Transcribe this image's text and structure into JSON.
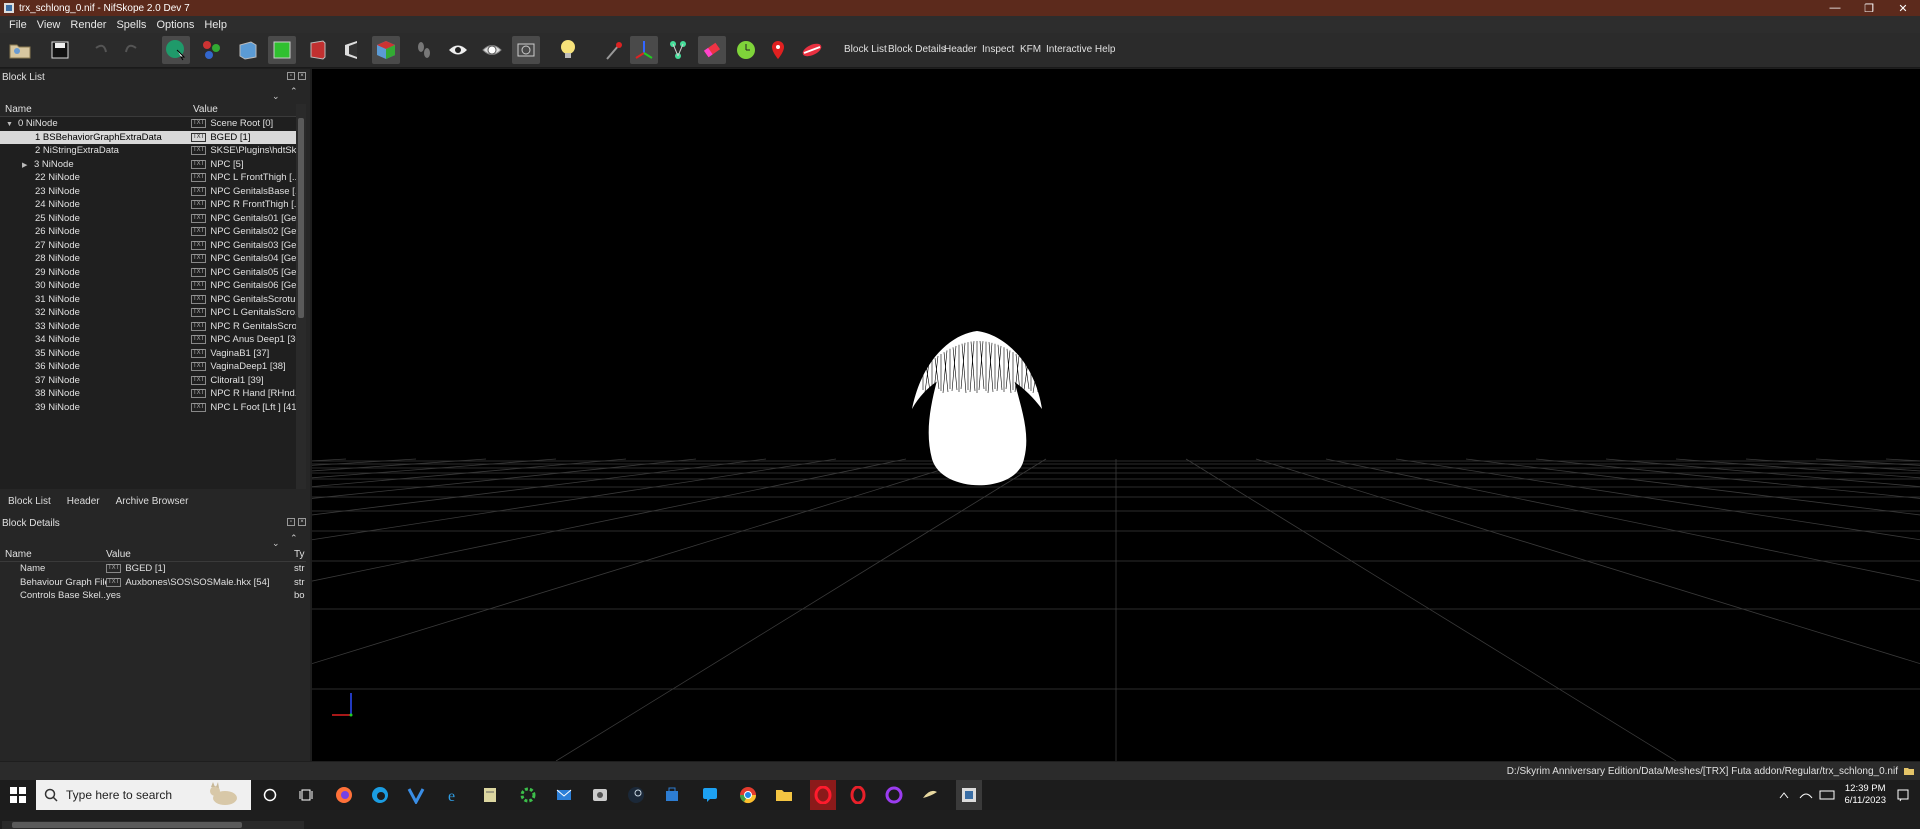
{
  "window": {
    "title": "trx_schlong_0.nif - NifSkope 2.0 Dev 7",
    "controls": {
      "minimize": "—",
      "maximize": "❐",
      "close": "✕"
    }
  },
  "menu": [
    "File",
    "View",
    "Render",
    "Spells",
    "Options",
    "Help"
  ],
  "toolbar": {
    "text_buttons": [
      "Block List",
      "Block Details",
      "Header",
      "Inspect",
      "KFM",
      "Interactive Help"
    ]
  },
  "block_list": {
    "title": "Block List",
    "columns": {
      "name": "Name",
      "value": "Value"
    },
    "rows": [
      {
        "name": "0 NiNode",
        "value": "Scene Root [0]"
      },
      {
        "name": "1 BSBehaviorGraphExtraData",
        "value": "BGED [1]"
      },
      {
        "name": "2 NiStringExtraData",
        "value": "SKSE\\Plugins\\hdtSk..."
      },
      {
        "name": "3 NiNode",
        "value": "NPC [5]"
      },
      {
        "name": "22 NiNode",
        "value": "NPC L FrontThigh [..."
      },
      {
        "name": "23 NiNode",
        "value": "NPC GenitalsBase [..."
      },
      {
        "name": "24 NiNode",
        "value": "NPC R FrontThigh [..."
      },
      {
        "name": "25 NiNode",
        "value": "NPC Genitals01 [Ge..."
      },
      {
        "name": "26 NiNode",
        "value": "NPC Genitals02 [Ge..."
      },
      {
        "name": "27 NiNode",
        "value": "NPC Genitals03 [Ge..."
      },
      {
        "name": "28 NiNode",
        "value": "NPC Genitals04 [Ge..."
      },
      {
        "name": "29 NiNode",
        "value": "NPC Genitals05 [Ge..."
      },
      {
        "name": "30 NiNode",
        "value": "NPC Genitals06 [Ge..."
      },
      {
        "name": "31 NiNode",
        "value": "NPC GenitalsScrotu..."
      },
      {
        "name": "32 NiNode",
        "value": "NPC L GenitalsScro..."
      },
      {
        "name": "33 NiNode",
        "value": "NPC R GenitalsScro..."
      },
      {
        "name": "34 NiNode",
        "value": "NPC Anus Deep1 [36]"
      },
      {
        "name": "35 NiNode",
        "value": "VaginaB1 [37]"
      },
      {
        "name": "36 NiNode",
        "value": "VaginaDeep1 [38]"
      },
      {
        "name": "37 NiNode",
        "value": "Clitoral1 [39]"
      },
      {
        "name": "38 NiNode",
        "value": "NPC R Hand [RHnd..."
      },
      {
        "name": "39 NiNode",
        "value": "NPC L Foot [Lft ] [41]"
      }
    ],
    "tabs": [
      "Block List",
      "Header",
      "Archive Browser"
    ]
  },
  "block_details": {
    "title": "Block Details",
    "columns": {
      "name": "Name",
      "value": "Value",
      "type": "Ty"
    },
    "rows": [
      {
        "name": "Name",
        "value": "BGED [1]",
        "type": "str"
      },
      {
        "name": "Behaviour Graph File",
        "value": "Auxbones\\SOS\\SOSMale.hkx [54]",
        "type": "str"
      },
      {
        "name": "Controls Base Skel...",
        "value": "yes",
        "type": "bo"
      }
    ]
  },
  "status": {
    "path": "D:/Skyrim Anniversary Edition/Data/Meshes/[TRX] Futa addon/Regular/trx_schlong_0.nif"
  },
  "taskbar": {
    "search_placeholder": "Type here to search",
    "time": "12:39 PM",
    "date": "6/11/2023"
  },
  "colors": {
    "titlebar": "#5c2a1c",
    "viewport_bg": "#000000",
    "grid": "#3a3a3a"
  }
}
